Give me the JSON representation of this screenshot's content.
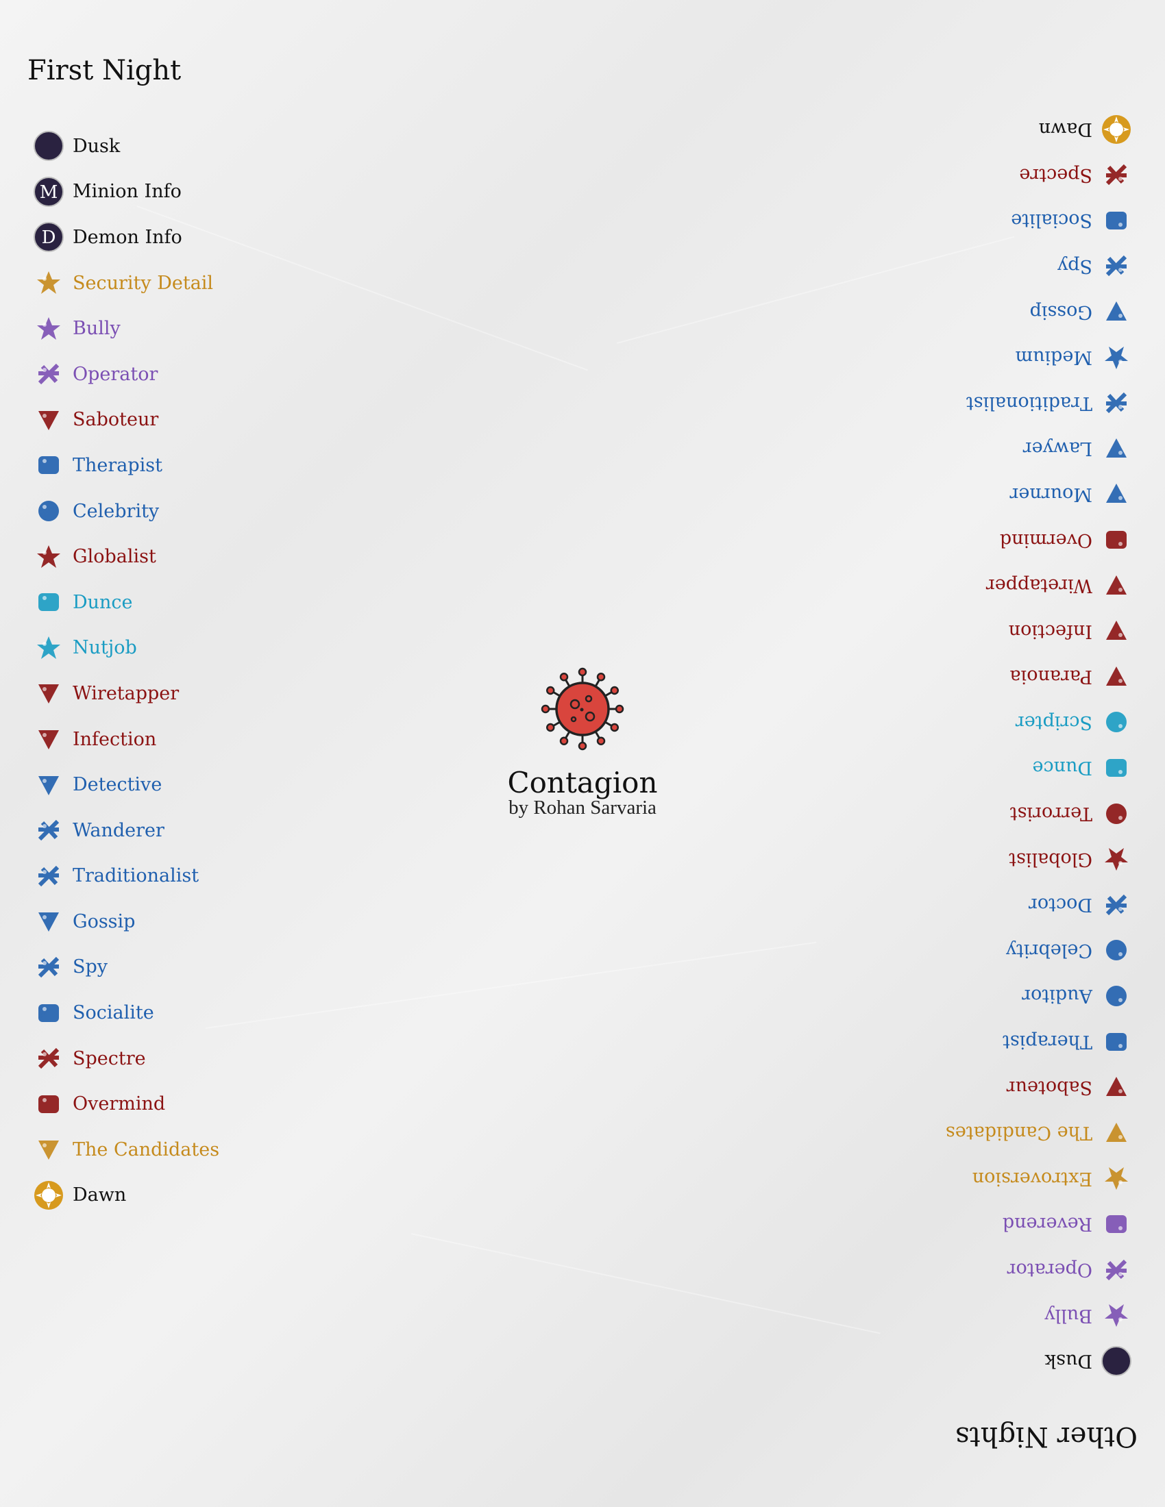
{
  "first_night": {
    "heading": "First Night",
    "items": [
      {
        "label": "Dusk",
        "color": "#111111",
        "icon": "moon-icon"
      },
      {
        "label": "Minion Info",
        "color": "#111111",
        "icon": "minion-info-icon",
        "letter": "M"
      },
      {
        "label": "Demon Info",
        "color": "#111111",
        "icon": "demon-info-icon",
        "letter": "D"
      },
      {
        "label": "Security Detail",
        "color": "#c58a1c",
        "icon": "security-detail-icon"
      },
      {
        "label": "Bully",
        "color": "#7b4fb3",
        "icon": "bully-icon"
      },
      {
        "label": "Operator",
        "color": "#7b4fb3",
        "icon": "operator-icon"
      },
      {
        "label": "Saboteur",
        "color": "#8b1212",
        "icon": "saboteur-icon"
      },
      {
        "label": "Therapist",
        "color": "#1f5fae",
        "icon": "therapist-icon"
      },
      {
        "label": "Celebrity",
        "color": "#1f5fae",
        "icon": "celebrity-icon"
      },
      {
        "label": "Globalist",
        "color": "#8b1212",
        "icon": "globalist-icon"
      },
      {
        "label": "Dunce",
        "color": "#1a9cc3",
        "icon": "dunce-icon"
      },
      {
        "label": "Nutjob",
        "color": "#1a9cc3",
        "icon": "nutjob-icon"
      },
      {
        "label": "Wiretapper",
        "color": "#8b1212",
        "icon": "wiretapper-icon"
      },
      {
        "label": "Infection",
        "color": "#8b1212",
        "icon": "infection-icon"
      },
      {
        "label": "Detective",
        "color": "#1f5fae",
        "icon": "detective-icon"
      },
      {
        "label": "Wanderer",
        "color": "#1f5fae",
        "icon": "wanderer-icon"
      },
      {
        "label": "Traditionalist",
        "color": "#1f5fae",
        "icon": "traditionalist-icon"
      },
      {
        "label": "Gossip",
        "color": "#1f5fae",
        "icon": "gossip-icon"
      },
      {
        "label": "Spy",
        "color": "#1f5fae",
        "icon": "spy-icon"
      },
      {
        "label": "Socialite",
        "color": "#1f5fae",
        "icon": "socialite-icon"
      },
      {
        "label": "Spectre",
        "color": "#8b1212",
        "icon": "spectre-icon"
      },
      {
        "label": "Overmind",
        "color": "#8b1212",
        "icon": "overmind-icon"
      },
      {
        "label": "The Candidates",
        "color": "#c58a1c",
        "icon": "candidates-icon"
      },
      {
        "label": "Dawn",
        "color": "#111111",
        "icon": "sun-icon"
      }
    ]
  },
  "other_nights": {
    "heading": "Other Nights",
    "items": [
      {
        "label": "Dusk",
        "color": "#111111",
        "icon": "moon-icon"
      },
      {
        "label": "Bully",
        "color": "#7b4fb3",
        "icon": "bully-icon"
      },
      {
        "label": "Operator",
        "color": "#7b4fb3",
        "icon": "operator-icon"
      },
      {
        "label": "Reverend",
        "color": "#7b4fb3",
        "icon": "reverend-icon"
      },
      {
        "label": "Extroversion",
        "color": "#c58a1c",
        "icon": "extroversion-icon"
      },
      {
        "label": "The Candidates",
        "color": "#c58a1c",
        "icon": "candidates-icon"
      },
      {
        "label": "Saboteur",
        "color": "#8b1212",
        "icon": "saboteur-icon"
      },
      {
        "label": "Therapist",
        "color": "#1f5fae",
        "icon": "therapist-icon"
      },
      {
        "label": "Auditor",
        "color": "#1f5fae",
        "icon": "auditor-icon"
      },
      {
        "label": "Celebrity",
        "color": "#1f5fae",
        "icon": "celebrity-icon"
      },
      {
        "label": "Doctor",
        "color": "#1f5fae",
        "icon": "doctor-icon"
      },
      {
        "label": "Globalist",
        "color": "#8b1212",
        "icon": "globalist-icon"
      },
      {
        "label": "Terrorist",
        "color": "#8b1212",
        "icon": "terrorist-icon"
      },
      {
        "label": "Dunce",
        "color": "#1a9cc3",
        "icon": "dunce-icon"
      },
      {
        "label": "Scripter",
        "color": "#1a9cc3",
        "icon": "scripter-icon"
      },
      {
        "label": "Paranoia",
        "color": "#8b1212",
        "icon": "paranoia-icon"
      },
      {
        "label": "Infection",
        "color": "#8b1212",
        "icon": "infection-icon"
      },
      {
        "label": "Wiretapper",
        "color": "#8b1212",
        "icon": "wiretapper-icon"
      },
      {
        "label": "Overmind",
        "color": "#8b1212",
        "icon": "overmind-icon"
      },
      {
        "label": "Mourner",
        "color": "#1f5fae",
        "icon": "mourner-icon"
      },
      {
        "label": "Lawyer",
        "color": "#1f5fae",
        "icon": "lawyer-icon"
      },
      {
        "label": "Traditionalist",
        "color": "#1f5fae",
        "icon": "traditionalist-icon"
      },
      {
        "label": "Medium",
        "color": "#1f5fae",
        "icon": "medium-icon"
      },
      {
        "label": "Gossip",
        "color": "#1f5fae",
        "icon": "gossip-icon"
      },
      {
        "label": "Spy",
        "color": "#1f5fae",
        "icon": "spy-icon"
      },
      {
        "label": "Socialite",
        "color": "#1f5fae",
        "icon": "socialite-icon"
      },
      {
        "label": "Spectre",
        "color": "#8b1212",
        "icon": "spectre-icon"
      },
      {
        "label": "Dawn",
        "color": "#111111",
        "icon": "sun-icon"
      }
    ]
  },
  "script": {
    "title": "Contagion",
    "author": "by Rohan Sarvaria",
    "logo": "virus-icon",
    "logo_color": "#d9453d"
  }
}
